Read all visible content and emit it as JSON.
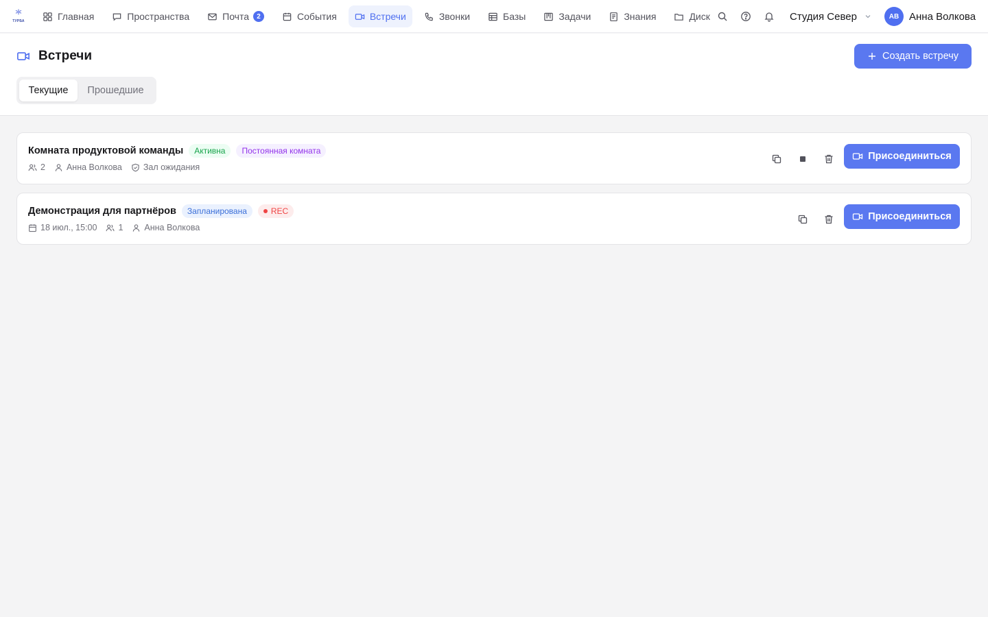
{
  "app": {
    "logo_text": "ТУРБА"
  },
  "nav": {
    "items": [
      {
        "label": "Главная",
        "icon": "grid-icon"
      },
      {
        "label": "Пространства",
        "icon": "chat-icon"
      },
      {
        "label": "Почта",
        "icon": "mail-icon",
        "badge": "2"
      },
      {
        "label": "События",
        "icon": "calendar-icon"
      },
      {
        "label": "Встречи",
        "icon": "video-icon",
        "active": true
      },
      {
        "label": "Звонки",
        "icon": "phone-icon"
      },
      {
        "label": "Базы",
        "icon": "table-icon"
      },
      {
        "label": "Задачи",
        "icon": "kanban-icon"
      },
      {
        "label": "Знания",
        "icon": "book-icon"
      },
      {
        "label": "Диск",
        "icon": "folder-icon"
      }
    ]
  },
  "topbar": {
    "workspace": "Студия Север",
    "user_initials": "АВ",
    "user_name": "Анна Волкова"
  },
  "page": {
    "title": "Встречи",
    "create_button": "Создать встречу",
    "tabs": [
      {
        "label": "Текущие",
        "active": true
      },
      {
        "label": "Прошедшие",
        "active": false
      }
    ]
  },
  "meetings": [
    {
      "title": "Комната продуктовой команды",
      "status": "Активна",
      "type_tag": "Постоянная комната",
      "participants": "2",
      "owner": "Анна Волкова",
      "waiting_room": "Зал ожидания",
      "join_label": "Присоединиться"
    },
    {
      "title": "Демонстрация для партнёров",
      "status": "Запланирована",
      "rec_tag": "REC",
      "date": "18 июл., 15:00",
      "participants": "1",
      "owner": "Анна Волкова",
      "join_label": "Присоединиться"
    }
  ],
  "colors": {
    "accent": "#5a78f0",
    "active_nav_bg": "#eef2fd",
    "status_active": "#16a34a",
    "status_planned": "#3b6fd8",
    "rec": "#ef4444",
    "tag_permanent": "#9333ea"
  }
}
